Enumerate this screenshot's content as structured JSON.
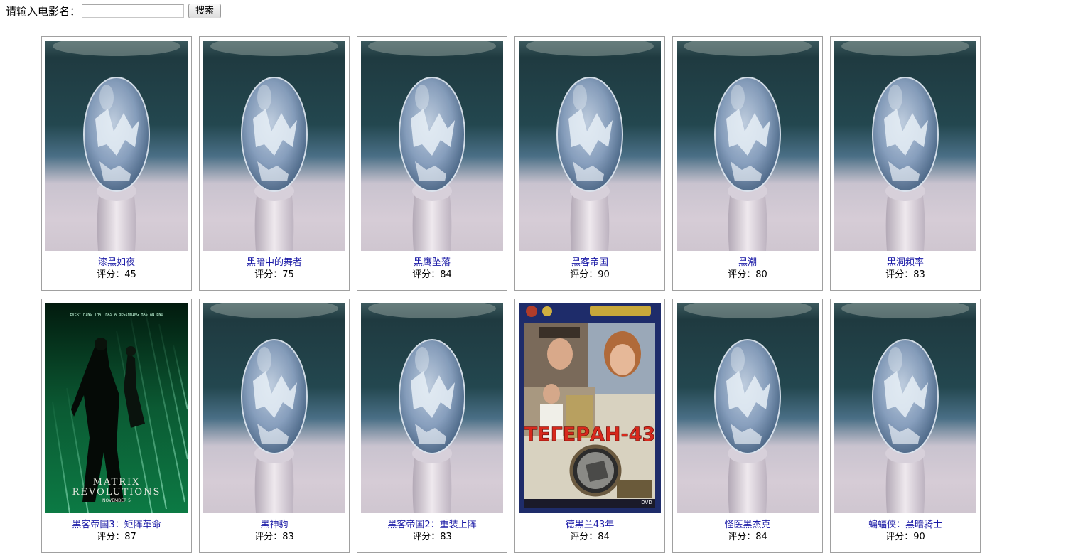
{
  "search": {
    "label": "请输入电影名：",
    "value": "",
    "placeholder": "",
    "button_label": "搜索"
  },
  "movies": [
    {
      "title": "漆黑如夜",
      "score_label": "评分：45",
      "poster": "default"
    },
    {
      "title": "黑暗中的舞者",
      "score_label": "评分：75",
      "poster": "default"
    },
    {
      "title": "黑鹰坠落",
      "score_label": "评分：84",
      "poster": "default"
    },
    {
      "title": "黑客帝国",
      "score_label": "评分：90",
      "poster": "default"
    },
    {
      "title": "黑潮",
      "score_label": "评分：80",
      "poster": "default"
    },
    {
      "title": "黑洞频率",
      "score_label": "评分：83",
      "poster": "default"
    },
    {
      "title": "黑客帝国3：矩阵革命",
      "score_label": "评分：87",
      "poster": "matrix",
      "poster_text": {
        "tagline": "EVERYTHING THAT HAS A BEGINNING HAS AN END",
        "line1": "MATRIX",
        "line2": "REVOLUTIONS",
        "date": "NOVEMBER 5"
      }
    },
    {
      "title": "黑神驹",
      "score_label": "评分：83",
      "poster": "default"
    },
    {
      "title": "黑客帝国2：重装上阵",
      "score_label": "评分：83",
      "poster": "default"
    },
    {
      "title": "德黑兰43年",
      "score_label": "评分：84",
      "poster": "tehran",
      "poster_text": {
        "main": "ТЕГЕРАН-43",
        "badge": "DVD"
      }
    },
    {
      "title": "怪医黑杰克",
      "score_label": "评分：84",
      "poster": "default"
    },
    {
      "title": "蝙蝠侠：黑暗骑士",
      "score_label": "评分：90",
      "poster": "default"
    }
  ],
  "colors": {
    "link": "#1a1aa6",
    "card_border": "#a0a0a0"
  }
}
